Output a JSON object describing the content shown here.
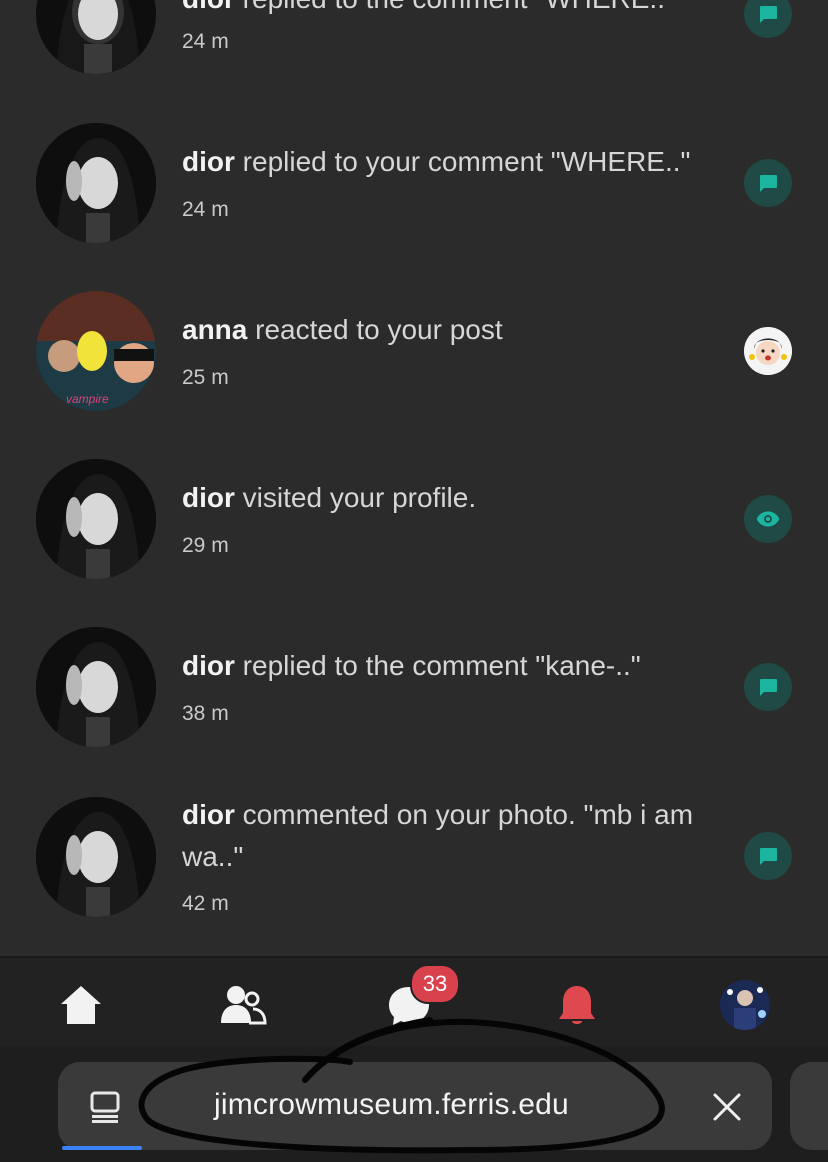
{
  "notifications": [
    {
      "user": "dior",
      "action": "replied to the comment \"WHERE..\"",
      "time": "24 m",
      "badge_icon": "comment-icon",
      "avatar": "dior"
    },
    {
      "user": "dior",
      "action": "replied to your comment \"WHERE..\"",
      "time": "24 m",
      "badge_icon": "comment-icon",
      "avatar": "dior"
    },
    {
      "user": "anna",
      "action": "reacted to your post",
      "time": "25 m",
      "badge_icon": "reaction-sticker",
      "avatar": "anna"
    },
    {
      "user": "dior",
      "action": "visited your profile.",
      "time": "29 m",
      "badge_icon": "eye-icon",
      "avatar": "dior"
    },
    {
      "user": "dior",
      "action": "replied to the comment \"kane-..\"",
      "time": "38 m",
      "badge_icon": "comment-icon",
      "avatar": "dior"
    },
    {
      "user": "dior",
      "action": "commented on your photo. \"mb i am wa..\"",
      "time": "42 m",
      "badge_icon": "comment-icon",
      "avatar": "dior"
    }
  ],
  "nav": {
    "items": [
      "home-icon",
      "friends-icon",
      "messages-icon",
      "notifications-icon",
      "profile-avatar"
    ],
    "messages_count": "33",
    "active": "notifications"
  },
  "browser": {
    "url": "jimcrowmuseum.ferris.edu"
  },
  "colors": {
    "background": "#2b2b2b",
    "badge_bg": "#1f4a46",
    "badge_icon": "#1bb5a0",
    "active_nav": "#e0484f",
    "count_badge": "#d9414d",
    "tab_underline": "#3b82f6"
  }
}
